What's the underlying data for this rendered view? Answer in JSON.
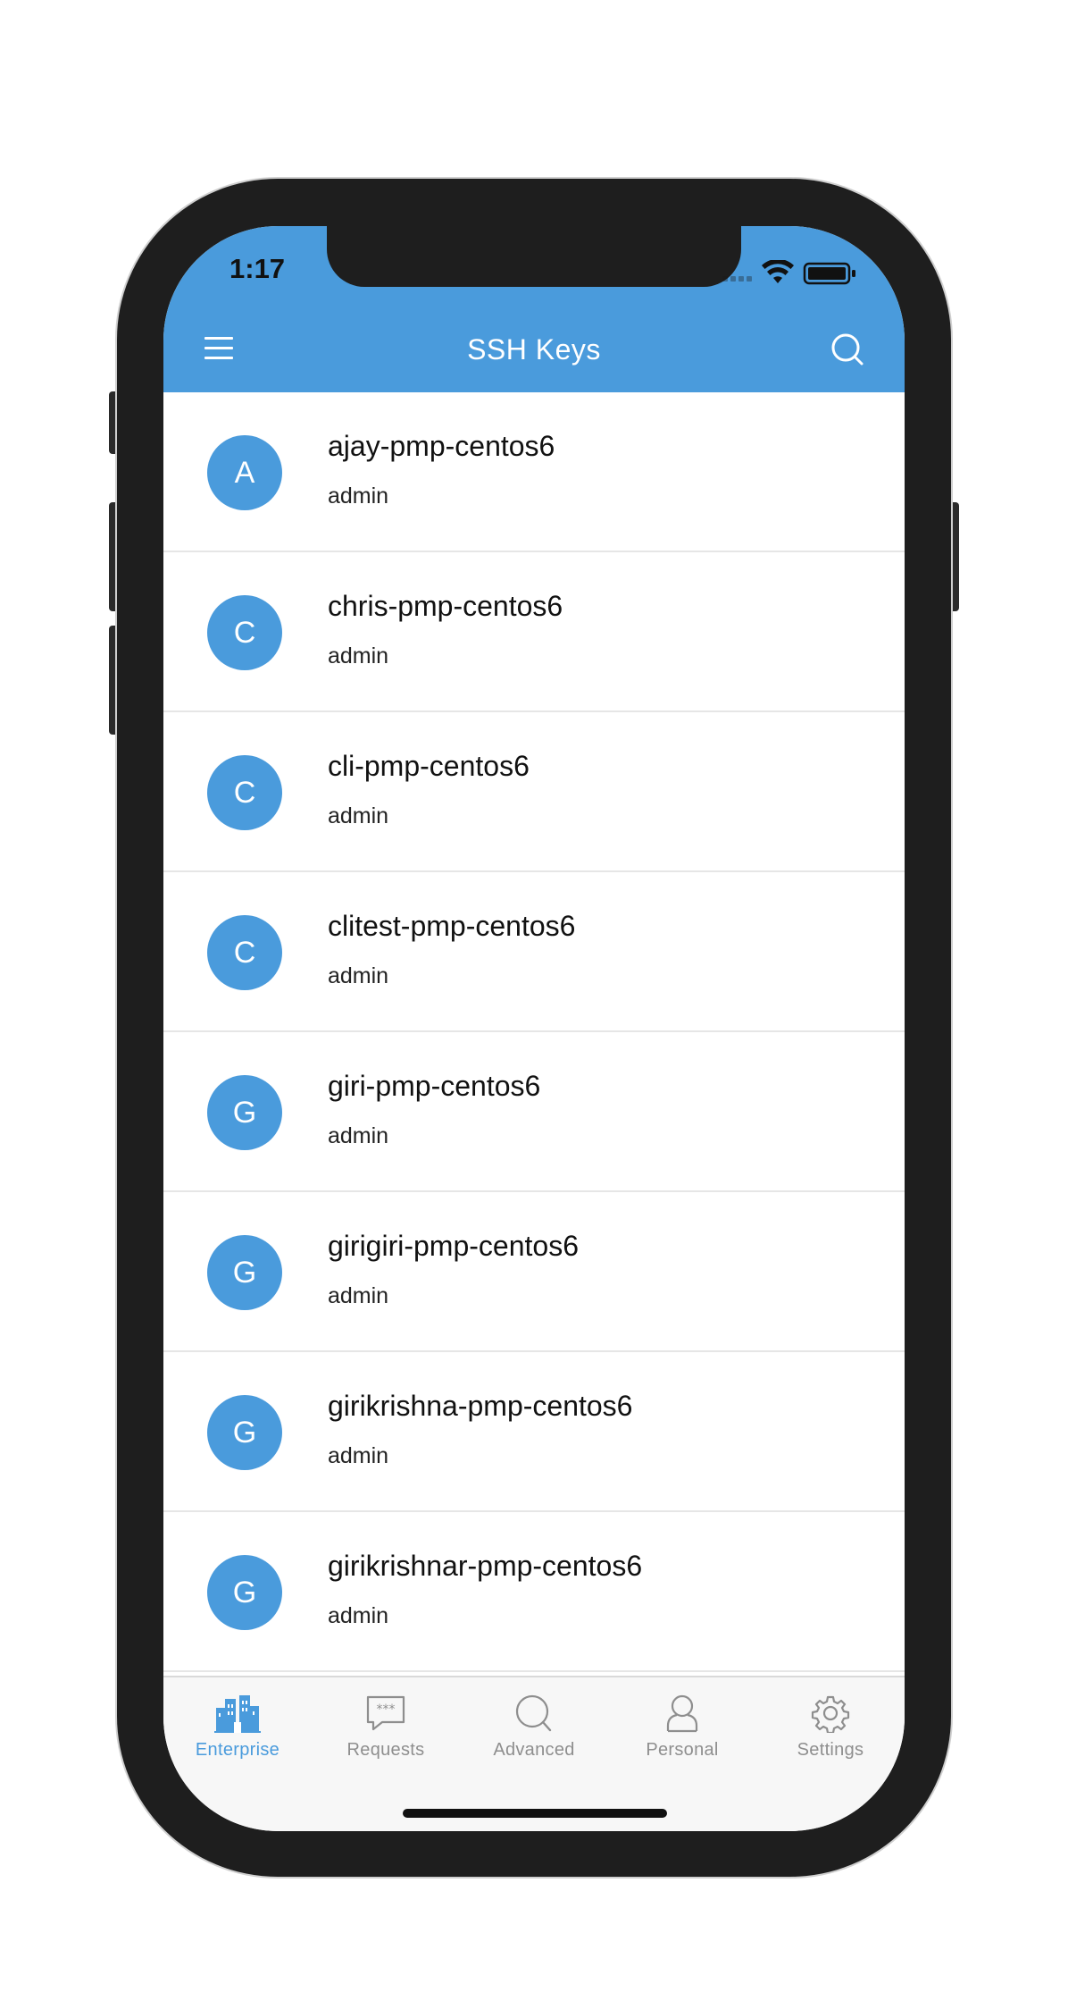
{
  "status": {
    "time": "1:17"
  },
  "header": {
    "title": "SSH Keys",
    "menu_icon": "hamburger-menu-icon",
    "search_icon": "search-icon"
  },
  "keys": [
    {
      "initial": "A",
      "name": "ajay-pmp-centos6",
      "owner": "admin"
    },
    {
      "initial": "C",
      "name": "chris-pmp-centos6",
      "owner": "admin"
    },
    {
      "initial": "C",
      "name": "cli-pmp-centos6",
      "owner": "admin"
    },
    {
      "initial": "C",
      "name": "clitest-pmp-centos6",
      "owner": "admin"
    },
    {
      "initial": "G",
      "name": "giri-pmp-centos6",
      "owner": "admin"
    },
    {
      "initial": "G",
      "name": "girigiri-pmp-centos6",
      "owner": "admin"
    },
    {
      "initial": "G",
      "name": "girikrishna-pmp-centos6",
      "owner": "admin"
    },
    {
      "initial": "G",
      "name": "girikrishnar-pmp-centos6",
      "owner": "admin"
    }
  ],
  "tabs": [
    {
      "label": "Enterprise",
      "icon": "enterprise-icon",
      "active": true
    },
    {
      "label": "Requests",
      "icon": "requests-icon",
      "active": false
    },
    {
      "label": "Advanced",
      "icon": "advanced-search-icon",
      "active": false
    },
    {
      "label": "Personal",
      "icon": "personal-icon",
      "active": false
    },
    {
      "label": "Settings",
      "icon": "settings-gear-icon",
      "active": false
    }
  ],
  "colors": {
    "accent": "#4a9bdc",
    "inactive": "#8e8e8e",
    "frame": "#1e1e1e"
  }
}
